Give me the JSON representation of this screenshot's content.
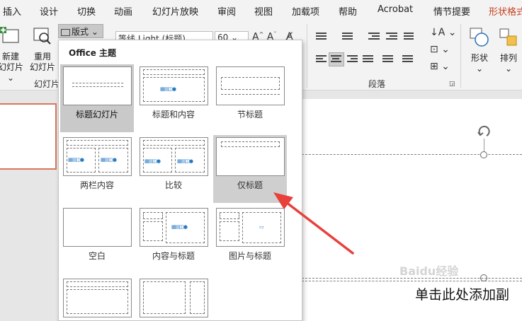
{
  "tabs": [
    "插入",
    "设计",
    "切换",
    "动画",
    "幻灯片放映",
    "审阅",
    "视图",
    "加载项",
    "帮助",
    "Acrobat",
    "情节提要",
    "形状格式"
  ],
  "ribbon": {
    "new_slide_label_1": "新建",
    "new_slide_label_2": "幻灯片",
    "reuse_label_1": "重用",
    "reuse_label_2": "幻灯片",
    "layout_button": "版式",
    "slides_group": "幻灯片",
    "font_name": "等线 Light (标题)",
    "font_size": "60",
    "paragraph_group": "段落",
    "shape_label": "形状",
    "arrange_label": "排列"
  },
  "gallery": {
    "title": "Office 主题",
    "layouts": [
      {
        "label": "标题幻灯片"
      },
      {
        "label": "标题和内容"
      },
      {
        "label": "节标题"
      },
      {
        "label": "两栏内容"
      },
      {
        "label": "比较"
      },
      {
        "label": "仅标题"
      },
      {
        "label": "空白"
      },
      {
        "label": "内容与标题"
      },
      {
        "label": "图片与标题"
      }
    ]
  },
  "slide": {
    "subtitle_placeholder": "单击此处添加副"
  },
  "watermark": "Baidu经验",
  "colors": {
    "shape_format_tab": "#c43e1c",
    "thumbnail_border": "#d8785a",
    "selected_layout": "#c9c9c9",
    "arrow": "#e8403a"
  }
}
